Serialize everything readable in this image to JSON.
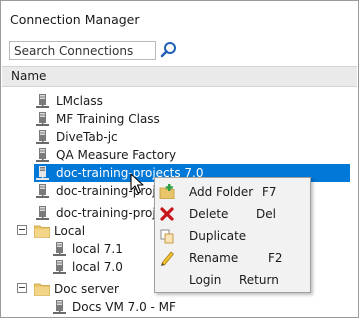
{
  "title": "Connection Manager",
  "search": {
    "placeholder": "Search Connections"
  },
  "column_header": "Name",
  "tree": {
    "connections": [
      "LMclass",
      "MF Training Class",
      "DiveTab-jc",
      "QA Measure Factory",
      "doc-training-projects 7.0",
      "doc-training-proje",
      "doc-training-proje"
    ],
    "folders": [
      {
        "name": "Local",
        "items": [
          "local 7.1",
          "local 7.0"
        ]
      },
      {
        "name": "Doc server",
        "items": [
          "Docs VM 7.0 - MF"
        ]
      }
    ]
  },
  "context_menu": [
    {
      "label": "Add Folder",
      "shortcut": "F7",
      "icon": "add-folder-icon"
    },
    {
      "label": "Delete",
      "shortcut": "Del",
      "icon": "delete-icon"
    },
    {
      "label": "Duplicate",
      "shortcut": "",
      "icon": "duplicate-icon"
    },
    {
      "label": "Rename",
      "shortcut": "F2",
      "icon": "rename-icon"
    },
    {
      "label": "Login",
      "shortcut": "Return",
      "icon": ""
    }
  ],
  "colors": {
    "selection": "#0078d7",
    "header_bg": "#eaeaea",
    "menu_bg": "#f2f2f2"
  }
}
